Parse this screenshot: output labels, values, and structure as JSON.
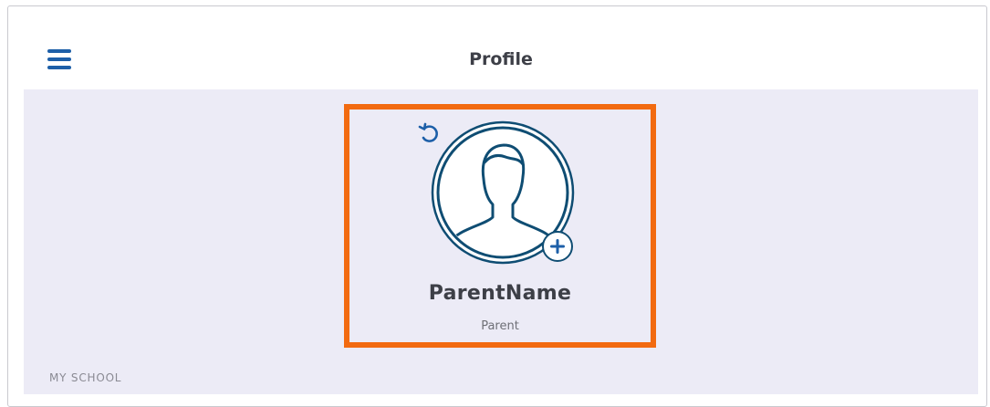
{
  "header": {
    "title": "Profile",
    "menu_icon": "hamburger-menu-icon"
  },
  "profile": {
    "name": "ParentName",
    "role": "Parent",
    "reset_icon": "undo-icon",
    "avatar_icon": "person-silhouette-icon",
    "add_photo_icon": "plus-icon"
  },
  "sections": {
    "my_school_label": "MY SCHOOL"
  },
  "colors": {
    "accent": "#1d5fa8",
    "highlight": "#f26a10",
    "background": "#ecebf6",
    "avatar_ring": "#0f4d73",
    "text_dark": "#3d3f47",
    "text_muted": "#6e6f76"
  }
}
